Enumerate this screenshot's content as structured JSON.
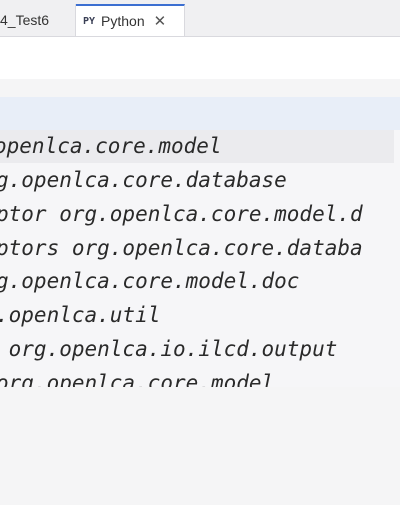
{
  "tabs": [
    {
      "label": "4_Test6"
    },
    {
      "icon": "PY",
      "label": "Python"
    }
  ],
  "editor": {
    "lines": [
      "openlca.core.model",
      "g.openlca.core.database",
      "ptor org.openlca.core.model.d",
      "ptors org.openlca.core.databa",
      "g.openlca.core.model.doc",
      ".openlca.util",
      " org.openlca.io.ilcd.output",
      "org.openlca.core.model"
    ]
  }
}
